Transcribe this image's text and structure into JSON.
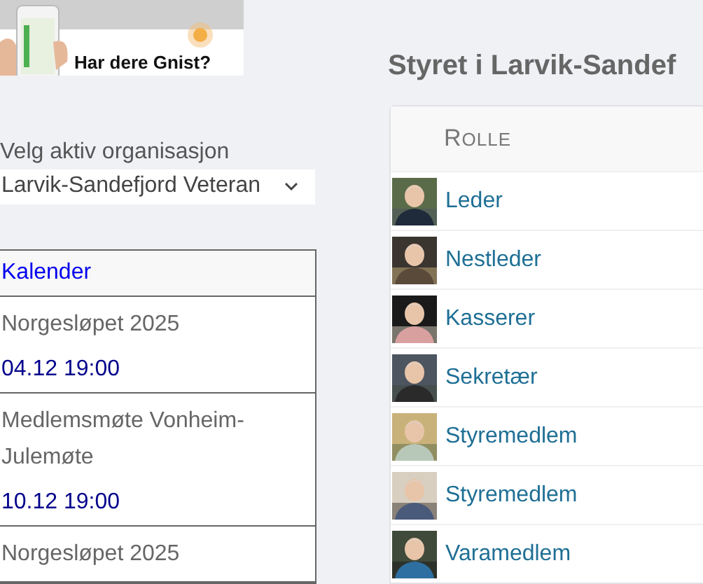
{
  "banner": {
    "caption": "Har dere Gnist?"
  },
  "organization_picker": {
    "label": "Velg aktiv organisasjon",
    "value": "Larvik-Sandefjord Veteran"
  },
  "calendar": {
    "title": "Kalender",
    "events": [
      {
        "title": "Norgesløpet 2025",
        "time": "04.12 19:00"
      },
      {
        "title": "Medlemsmøte Vonheim-Julemøte",
        "time": "10.12 19:00"
      },
      {
        "title": "Norgesløpet 2025"
      }
    ]
  },
  "board": {
    "heading": "Styret i Larvik-Sandef",
    "column": "ROLLE",
    "rows": [
      {
        "role": "Leder"
      },
      {
        "role": "Nestleder"
      },
      {
        "role": "Kasserer"
      },
      {
        "role": "Sekretær"
      },
      {
        "role": "Styremedlem"
      },
      {
        "role": "Styremedlem"
      },
      {
        "role": "Varamedlem"
      }
    ]
  }
}
